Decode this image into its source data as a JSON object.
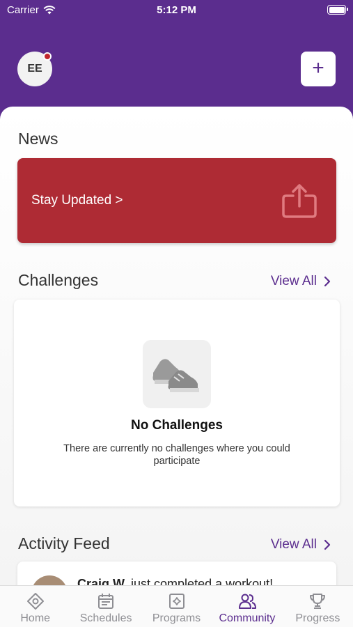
{
  "status_bar": {
    "carrier": "Carrier",
    "time": "5:12 PM"
  },
  "header": {
    "avatar_initials": "EE",
    "add_label": "+"
  },
  "news": {
    "title": "News",
    "card_label": "Stay Updated >",
    "card_color": "#ae2b34"
  },
  "challenges": {
    "title": "Challenges",
    "view_all": "View All",
    "empty_title": "No Challenges",
    "empty_desc": "There are currently no challenges where you could participate"
  },
  "activity_feed": {
    "title": "Activity Feed",
    "view_all": "View All",
    "items": [
      {
        "name": "Craig W.",
        "text": "just completed a workout!"
      }
    ]
  },
  "tabs": [
    {
      "label": "Home",
      "icon": "home-icon"
    },
    {
      "label": "Schedules",
      "icon": "calendar-icon"
    },
    {
      "label": "Programs",
      "icon": "programs-icon"
    },
    {
      "label": "Community",
      "icon": "community-icon",
      "active": true
    },
    {
      "label": "Progress",
      "icon": "trophy-icon"
    }
  ],
  "colors": {
    "brand": "#5b2d8e",
    "news_red": "#ae2b34"
  }
}
